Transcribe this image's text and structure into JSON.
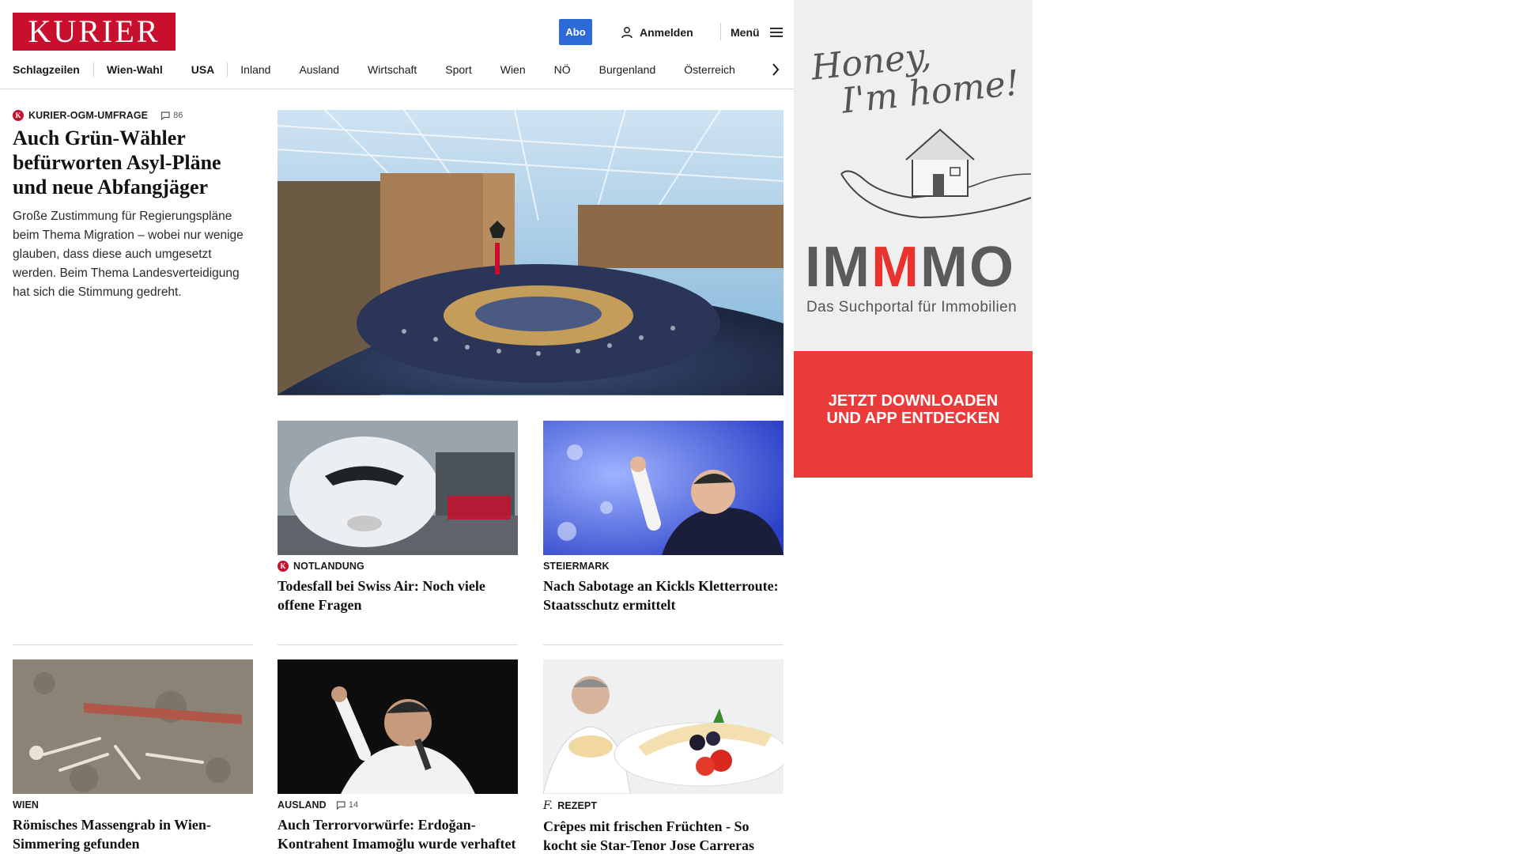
{
  "header": {
    "logo": "KURIER",
    "abo_label": "Abo",
    "login_label": "Anmelden",
    "menu_label": "Menü"
  },
  "nav": {
    "items": [
      "Schlagzeilen",
      "Wien-Wahl",
      "USA",
      "Inland",
      "Ausland",
      "Wirtschaft",
      "Sport",
      "Wien",
      "NÖ",
      "Burgenland",
      "Österreich"
    ]
  },
  "lead": {
    "kicker": "KURIER-OGM-UMFRAGE",
    "comments": "86",
    "headline": "Auch Grün-Wähler befürworten Asyl-Pläne und neue Abfangjäger",
    "teaser": "Große Zustimmung für Regierungspläne beim Thema Migration – wobei nur wenige glauben, dass diese auch umgesetzt werden. Beim Thema Landesverteidigung hat sich die Stimmung gedreht."
  },
  "cards": [
    {
      "kicker": "NOTLANDUNG",
      "headline": "Todesfall bei Swiss Air: Noch viele offene Fragen"
    },
    {
      "kicker": "STEIERMARK",
      "headline": "Nach Sabotage an Kickls Kletterroute: Staatsschutz ermittelt"
    },
    {
      "kicker": "WIEN",
      "headline": "Römisches Massengrab in Wien-Simmering gefunden"
    },
    {
      "kicker": "AUSLAND",
      "comments": "14",
      "headline": "Auch Terrorvorwürfe: Erdoğan-Kontrahent Imamoğlu wurde verhaftet"
    },
    {
      "kicker": "REZEPT",
      "headline": "Crêpes mit frischen Früchten - So kocht sie Star-Tenor Jose Carreras"
    }
  ],
  "ad": {
    "script_line1": "Honey,",
    "script_line2": "I'm home!",
    "brand_part1": "IM",
    "brand_part2": "M",
    "brand_part3": "MO",
    "subline": "Das Suchportal für Immobilien",
    "cta": "JETZT DOWNLOADEN UND APP ENTDECKEN"
  },
  "colors": {
    "brand_red": "#c8102e",
    "abo_blue": "#2d6ad8",
    "ad_red": "#ea3a3a"
  }
}
